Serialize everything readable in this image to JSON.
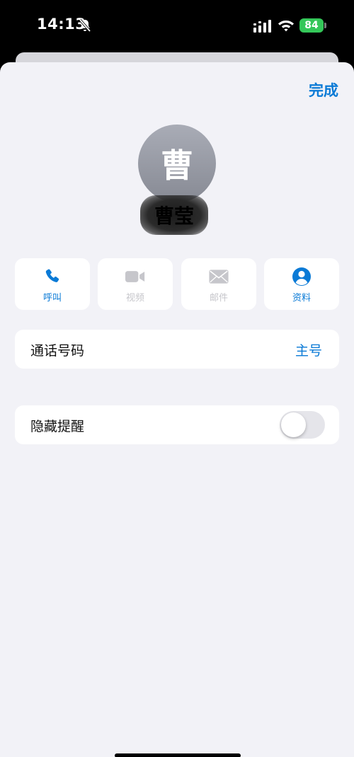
{
  "status_bar": {
    "time": "14:13",
    "battery": "84",
    "icons": [
      "bell-slash-icon",
      "cellular-signal-icon",
      "wifi-icon",
      "battery-icon"
    ],
    "battery_color": "#34c759"
  },
  "header": {
    "done_label": "完成"
  },
  "contact": {
    "avatar_initial": "曹",
    "name": "曹莹"
  },
  "actions": [
    {
      "label": "呼叫",
      "icon": "phone-icon",
      "enabled": true
    },
    {
      "label": "视频",
      "icon": "video-icon",
      "enabled": false
    },
    {
      "label": "邮件",
      "icon": "mail-icon",
      "enabled": false
    },
    {
      "label": "资料",
      "icon": "person-circle-icon",
      "enabled": true
    }
  ],
  "phone_row": {
    "label": "通话号码",
    "value": "主号"
  },
  "hide_alerts_row": {
    "label": "隐藏提醒",
    "toggle_on": false
  },
  "colors": {
    "accent": "#0a7ad6",
    "background": "#f2f2f7",
    "disabled": "#c6c6cb"
  }
}
